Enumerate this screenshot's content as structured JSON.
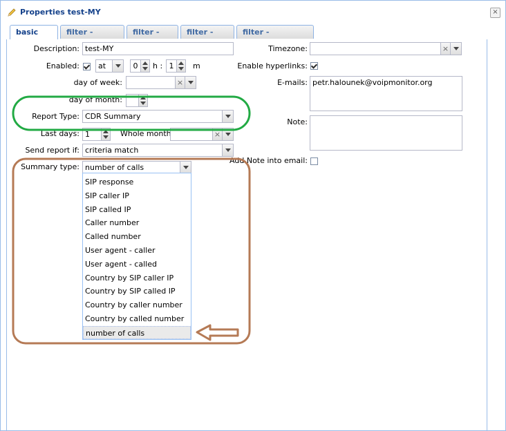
{
  "window": {
    "title": "Properties test-MY",
    "close_label": "×"
  },
  "tabs": [
    {
      "label": "basic data",
      "active": true
    },
    {
      "label": "filter - common",
      "active": false
    },
    {
      "label": "filter - RTP",
      "active": false
    },
    {
      "label": "filter - DSCP",
      "active": false
    },
    {
      "label": "filter - combination",
      "active": false
    }
  ],
  "form": {
    "description_label": "Description:",
    "description_value": "test-MY",
    "enabled_label": "Enabled:",
    "enabled_checked": true,
    "at_value": "at",
    "hour_value": "0",
    "h_label": "h :",
    "minute_value": "1",
    "m_label": "m",
    "day_of_week_label": "day of week:",
    "day_of_month_label": "day of month:",
    "report_type_label": "Report Type:",
    "report_type_value": "CDR Summary",
    "last_days_label": "Last days:",
    "last_days_value": "1",
    "whole_month_label": "Whole month:",
    "send_report_if_label": "Send report if:",
    "send_report_if_value": "criteria match",
    "summary_type_label": "Summary type:",
    "summary_type_value": "number of calls",
    "timezone_label": "Timezone:",
    "timezone_value": "",
    "enable_hyperlinks_label": "Enable hyperlinks:",
    "enable_hyperlinks_checked": true,
    "emails_label": "E-mails:",
    "emails_value": "petr.halounek@voipmonitor.org",
    "note_label": "Note:",
    "note_value": "",
    "add_note_label": "Add Note into email:",
    "add_note_checked": false
  },
  "summary_type_options": [
    "SIP response",
    "SIP caller IP",
    "SIP called IP",
    "Caller number",
    "Called number",
    "User agent - caller",
    "User agent - called",
    "Country by SIP caller IP",
    "Country by SIP called IP",
    "Country by caller number",
    "Country by called number",
    "number of calls"
  ],
  "selected_option_index": 11,
  "annotations": {
    "green_ellipse_color": "#22aa44",
    "brown_box_color": "#b57a55",
    "arrow_color": "#b57a55"
  }
}
